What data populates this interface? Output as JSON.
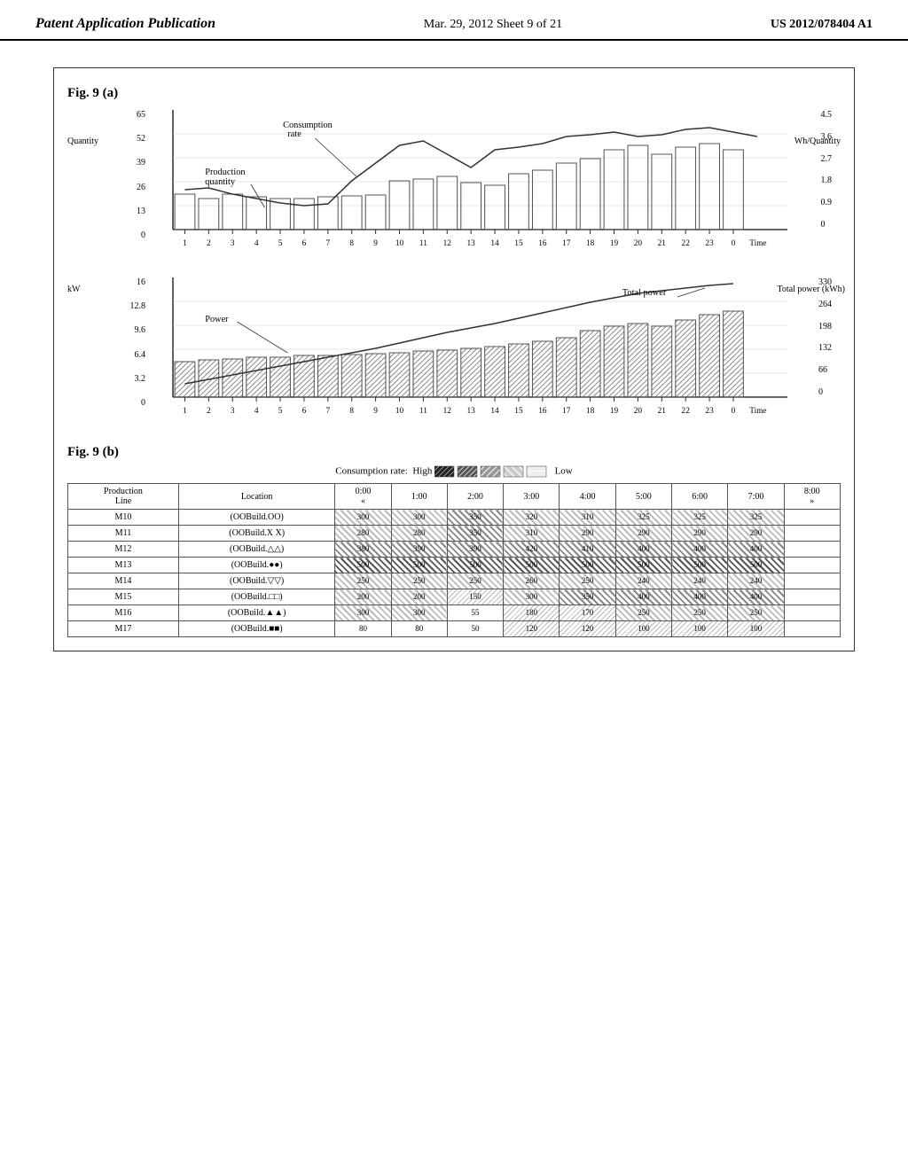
{
  "header": {
    "left": "Patent Application Publication",
    "center": "Mar. 29, 2012  Sheet 9 of 21",
    "right": "US 2012/078404 A1"
  },
  "fig9a_label": "Fig. 9 (a)",
  "fig9b_label": "Fig. 9 (b)",
  "chart1": {
    "title_y_left": "Quantity",
    "title_y_right": "Wh/Quantity",
    "label_production": "Production\nquantity",
    "label_consumption": "Consumption\nrate",
    "y_left_ticks": [
      "0",
      "13",
      "26",
      "39",
      "52",
      "65"
    ],
    "y_right_ticks": [
      "0",
      "0.9",
      "1.8",
      "2.7",
      "3.6",
      "4.5"
    ],
    "x_ticks": [
      "1",
      "2",
      "3",
      "4",
      "5",
      "6",
      "7",
      "8",
      "9",
      "10",
      "11",
      "12",
      "13",
      "14",
      "15",
      "16",
      "17",
      "18",
      "19",
      "20",
      "21",
      "22",
      "23",
      "0"
    ],
    "x_title": "Time"
  },
  "chart2": {
    "title_y_left": "kW",
    "title_label": "Power",
    "title_y_right": "Total power (kWh)",
    "label_total": "Total power",
    "y_left_ticks": [
      "0",
      "3.2",
      "6.4",
      "9.6",
      "12.8",
      "16"
    ],
    "y_right_ticks": [
      "0",
      "66",
      "132",
      "198",
      "264",
      "330"
    ],
    "x_ticks": [
      "1",
      "2",
      "3",
      "4",
      "5",
      "6",
      "7",
      "8",
      "9",
      "10",
      "11",
      "12",
      "13",
      "14",
      "15",
      "16",
      "17",
      "18",
      "19",
      "20",
      "21",
      "22",
      "23",
      "0"
    ],
    "x_title": "Time"
  },
  "legend": {
    "text": "Consumption rate:  High",
    "low_text": "Low"
  },
  "table": {
    "col_headers": [
      "Production\nLine",
      "Location",
      "0:00\n«",
      "1:00",
      "2:00",
      "3:00",
      "4:00",
      "5:00",
      "6:00",
      "7:00",
      "8:00\n»"
    ],
    "rows": [
      {
        "line": "M10",
        "loc": "(OOBuild.OO)",
        "cells": [
          "300",
          "300",
          "350",
          "320",
          "310",
          "325",
          "325",
          "325"
        ]
      },
      {
        "line": "M11",
        "loc": "(OOBuild.X X)",
        "cells": [
          "280",
          "280",
          "350",
          "310",
          "290",
          "290",
          "290",
          "290"
        ]
      },
      {
        "line": "M12",
        "loc": "(OOBuild.△△)",
        "cells": [
          "380",
          "390",
          "390",
          "420",
          "410",
          "400",
          "400",
          "400"
        ]
      },
      {
        "line": "M13",
        "loc": "(OOBuild.●●)",
        "cells": [
          "500",
          "500",
          "500",
          "500",
          "500",
          "500",
          "500",
          "500"
        ]
      },
      {
        "line": "M14",
        "loc": "(OOBuild.▽▽)",
        "cells": [
          "250",
          "250",
          "250",
          "260",
          "250",
          "240",
          "240",
          "240"
        ]
      },
      {
        "line": "M15",
        "loc": "(OOBuild.□□)",
        "cells": [
          "200",
          "200",
          "150",
          "300",
          "350",
          "400",
          "400",
          "400"
        ]
      },
      {
        "line": "M16",
        "loc": "(OOBuild.▲▲)",
        "cells": [
          "300",
          "300",
          "55",
          "180",
          "170",
          "250",
          "250",
          "250"
        ]
      },
      {
        "line": "M17",
        "loc": "(OOBuild.■■)",
        "cells": [
          "80",
          "80",
          "50",
          "120",
          "120",
          "100",
          "100",
          "100"
        ]
      }
    ]
  }
}
